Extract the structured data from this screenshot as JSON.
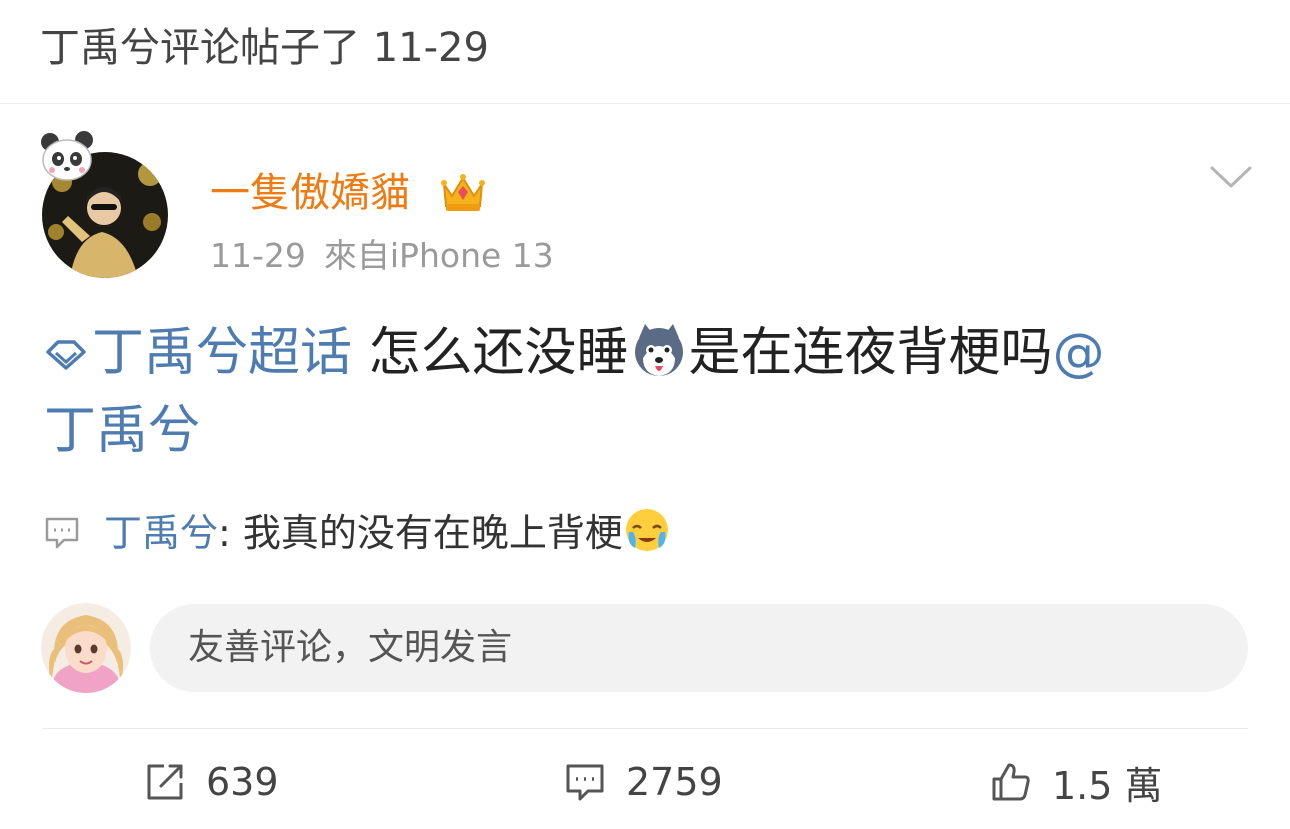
{
  "header": {
    "title": "丁禹兮评论帖子了 11-29"
  },
  "post": {
    "author": {
      "name": "一隻傲嬌貓",
      "badge_icon": "crown-icon"
    },
    "meta": {
      "time": "11-29",
      "source": "來自iPhone 13"
    },
    "body": {
      "topic": "丁禹兮超话",
      "text_before_emoji": " 怎么还没睡",
      "emoji_icon": "husky-dog-emoji",
      "text_after_emoji": "是在连夜背梗吗",
      "mention_at": "@",
      "mention_name": "丁禹兮"
    },
    "top_reply": {
      "author": "丁禹兮",
      "separator": ": ",
      "text": "我真的没有在晚上背梗",
      "emoji_icon": "crying-face-emoji"
    }
  },
  "comment_input": {
    "placeholder": "友善评论，文明发言"
  },
  "actions": {
    "repost_count": "639",
    "comment_count": "2759",
    "like_count": "1.5 萬"
  },
  "colors": {
    "username": "#ee7b14",
    "link": "#4e7cb1",
    "meta": "#9a9a9a",
    "input_bg": "#f2f2f2"
  }
}
